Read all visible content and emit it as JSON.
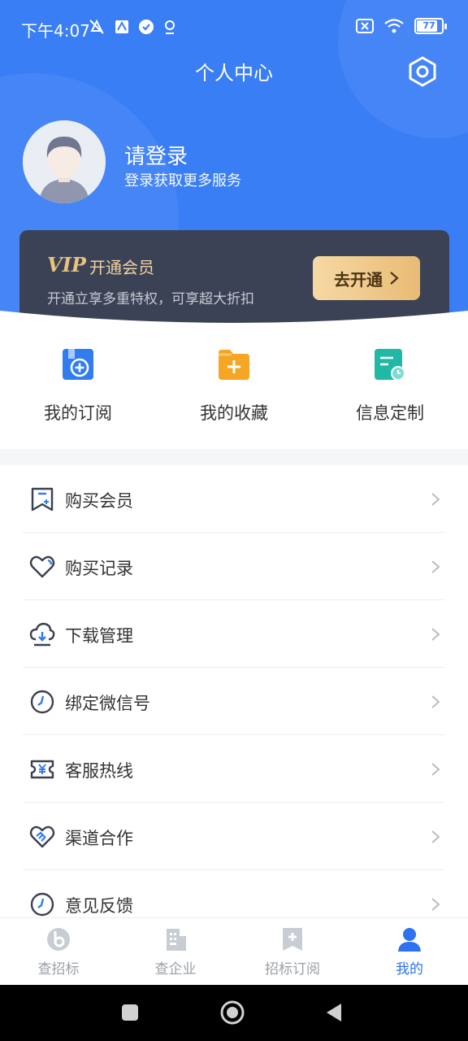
{
  "status_bar": {
    "time": "下午4:07",
    "battery": "77"
  },
  "header": {
    "title": "个人中心"
  },
  "profile": {
    "login_title": "请登录",
    "login_subtitle": "登录获取更多服务"
  },
  "vip": {
    "logo": "VIP",
    "title": "开通会员",
    "description": "开通立享多重特权，可享超大折扣",
    "button_label": "去开通"
  },
  "quick_actions": [
    {
      "label": "我的订阅",
      "icon": "subscribe-icon",
      "color": "#2f7df0"
    },
    {
      "label": "我的收藏",
      "icon": "favorites-folder-icon",
      "color": "#f5a623"
    },
    {
      "label": "信息定制",
      "icon": "custom-info-icon",
      "color": "#21b8a5"
    }
  ],
  "menu": [
    {
      "label": "购买会员",
      "icon": "bookmark-icon"
    },
    {
      "label": "购买记录",
      "icon": "heart-icon"
    },
    {
      "label": "下载管理",
      "icon": "cloud-download-icon"
    },
    {
      "label": "绑定微信号",
      "icon": "clock-icon"
    },
    {
      "label": "客服热线",
      "icon": "ticket-yuan-icon"
    },
    {
      "label": "渠道合作",
      "icon": "handshake-heart-icon"
    },
    {
      "label": "意见反馈",
      "icon": "clock-icon"
    }
  ],
  "tabbar": [
    {
      "label": "查招标",
      "icon": "b-logo-icon",
      "active": false
    },
    {
      "label": "查企业",
      "icon": "building-icon",
      "active": false
    },
    {
      "label": "招标订阅",
      "icon": "bookmark-plus-icon",
      "active": false
    },
    {
      "label": "我的",
      "icon": "user-icon",
      "active": true
    }
  ],
  "colors": {
    "primary": "#3a7ef5",
    "vip_card": "#3c4256",
    "vip_gold": "#e8c27e",
    "active_tab": "#2e72f0",
    "inactive_tab": "#9aa0a8"
  }
}
